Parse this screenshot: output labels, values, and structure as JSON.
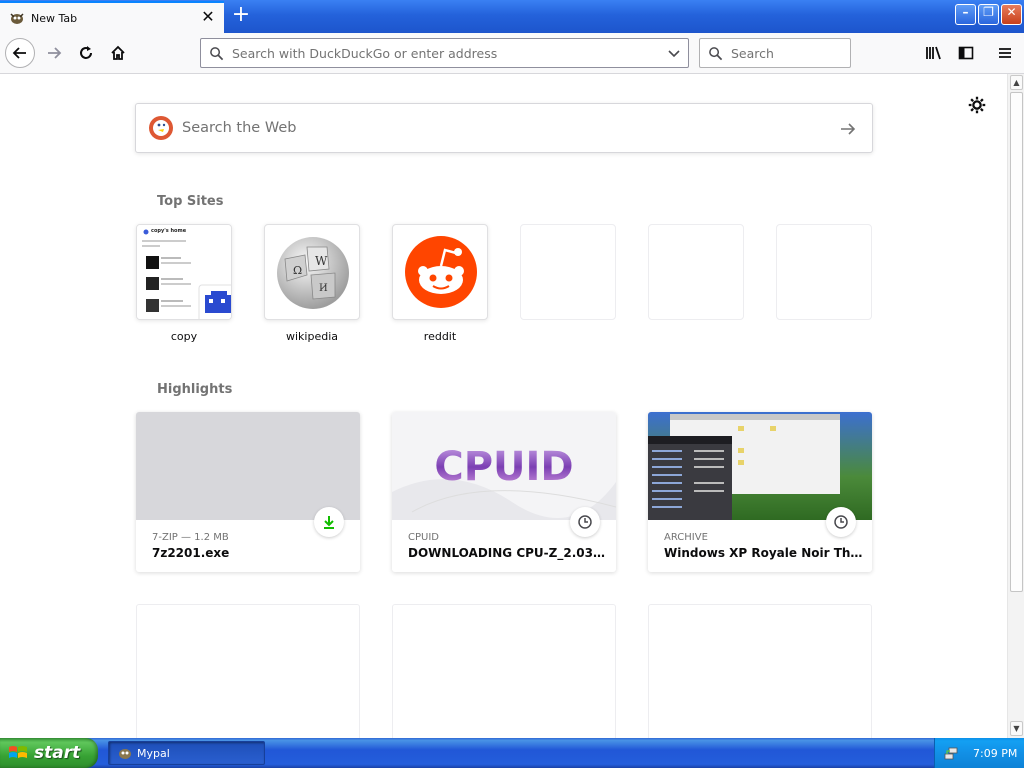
{
  "browser": {
    "tab": {
      "title": "New Tab",
      "close_glyph": "✕"
    },
    "new_tab_glyph": "+",
    "window_controls": {
      "minimize": "–",
      "maximize": "❐",
      "close": "✕"
    },
    "url_bar": {
      "placeholder": "Search with DuckDuckGo or enter address",
      "value": ""
    },
    "search_bar": {
      "placeholder": "Search"
    }
  },
  "new_tab_page": {
    "web_search": {
      "placeholder": "Search the Web"
    },
    "top_sites": {
      "title": "Top Sites",
      "items": [
        {
          "label": "copy",
          "thumb_title": "copy's home"
        },
        {
          "label": "wikipedia"
        },
        {
          "label": "reddit"
        },
        {
          "label": ""
        },
        {
          "label": ""
        },
        {
          "label": ""
        }
      ]
    },
    "highlights": {
      "title": "Highlights",
      "cards": [
        {
          "context": "7-ZIP — 1.2 MB",
          "title": "7z2201.exe",
          "badge_icon": "download-icon"
        },
        {
          "context": "CPUID",
          "title": "DOWNLOADING CPU-Z_2.03-EN....",
          "badge_icon": "clock-icon",
          "thumb_text": "CPUID"
        },
        {
          "context": "ARCHIVE",
          "title": "Windows XP Royale Noir Them...",
          "badge_icon": "clock-icon"
        }
      ]
    }
  },
  "taskbar": {
    "start_label": "start",
    "tasks": [
      {
        "label": "Mypal"
      }
    ],
    "clock": "7:09 PM"
  },
  "colors": {
    "accent": "#0a84ff",
    "reddit": "#ff4500",
    "download_green": "#12bc00",
    "xp_blue": "#245edb"
  }
}
